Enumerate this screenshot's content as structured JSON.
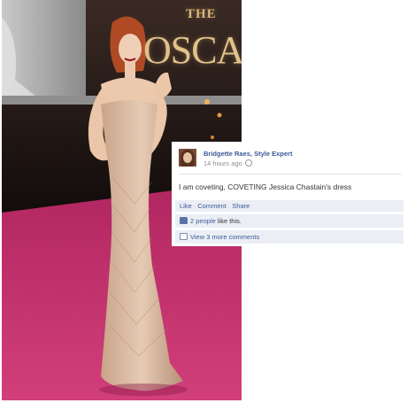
{
  "photo": {
    "wordmark_small": "THE",
    "wordmark_large": "OSCAR"
  },
  "post": {
    "author": "Bridgette Raes, Style Expert",
    "timestamp": "14 hours ago",
    "text": "I am coveting, COVETING Jessica Chastain's dress",
    "actions": {
      "like": "Like",
      "comment": "Comment",
      "share": "Share",
      "separator": "·"
    },
    "likes_count_text": "2 people",
    "likes_suffix": " like this.",
    "view_comments": "View 3 more comments"
  },
  "colors": {
    "link": "#3b5998",
    "carpet": "#c0306a",
    "panel": "#eceef5"
  },
  "icons": [
    "globe-icon",
    "like-thumb-icon",
    "comment-bubble-icon"
  ]
}
